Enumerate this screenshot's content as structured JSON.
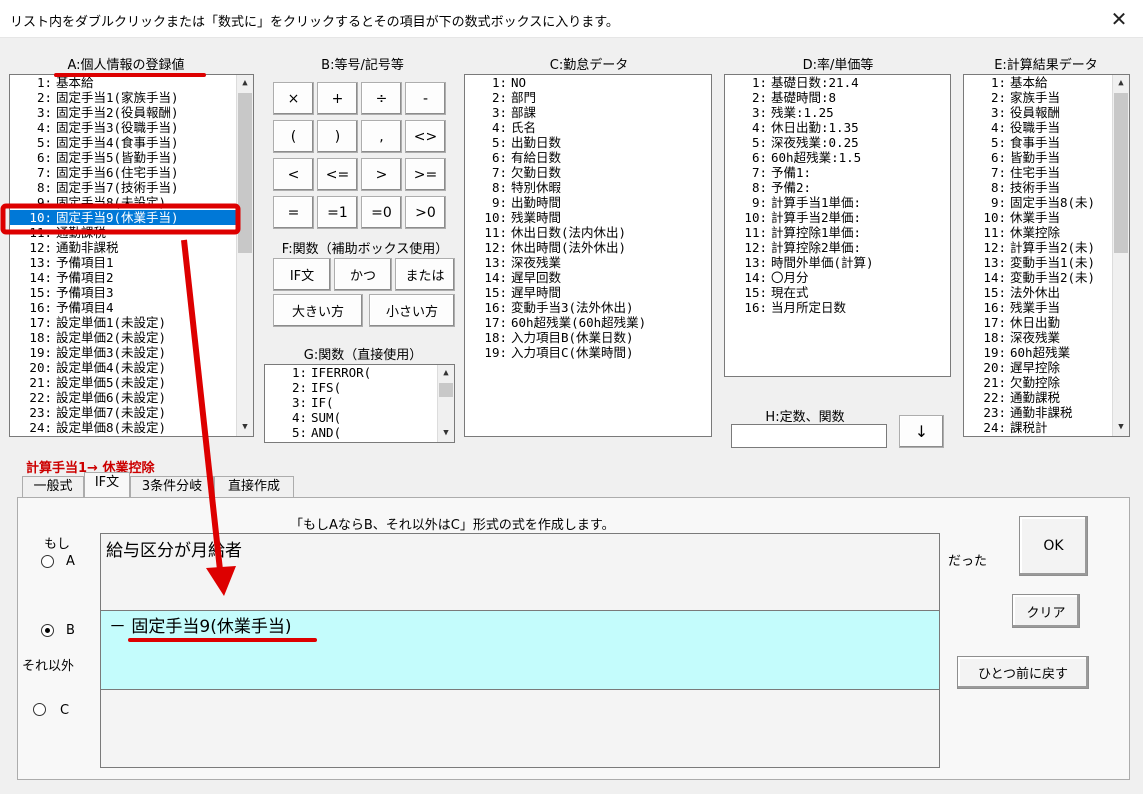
{
  "title": "リスト内をダブルクリックまたは「数式に」をクリックするとその項目が下の数式ボックスに入ります。",
  "close_glyph": "✕",
  "sections": {
    "a": "A:個人情報の登録値",
    "b": "B:等号/記号等",
    "c": "C:勤怠データ",
    "d": "D:率/単価等",
    "e": "E:計算結果データ",
    "f": "F:関数（補助ボックス使用）",
    "g": "G:関数（直接使用）",
    "h": "H:定数、関数"
  },
  "list_a": [
    {
      "n": "1:",
      "t": "基本給"
    },
    {
      "n": "2:",
      "t": "固定手当1(家族手当)"
    },
    {
      "n": "3:",
      "t": "固定手当2(役員報酬)"
    },
    {
      "n": "4:",
      "t": "固定手当3(役職手当)"
    },
    {
      "n": "5:",
      "t": "固定手当4(食事手当)"
    },
    {
      "n": "6:",
      "t": "固定手当5(皆勤手当)"
    },
    {
      "n": "7:",
      "t": "固定手当6(住宅手当)"
    },
    {
      "n": "8:",
      "t": "固定手当7(技術手当)"
    },
    {
      "n": "9:",
      "t": "固定手当8(未設定)"
    },
    {
      "n": "10:",
      "t": "固定手当9(休業手当)",
      "selected": true
    },
    {
      "n": "11:",
      "t": "通勤課税"
    },
    {
      "n": "12:",
      "t": "通勤非課税"
    },
    {
      "n": "13:",
      "t": "予備項目1"
    },
    {
      "n": "14:",
      "t": "予備項目2"
    },
    {
      "n": "15:",
      "t": "予備項目3"
    },
    {
      "n": "16:",
      "t": "予備項目4"
    },
    {
      "n": "17:",
      "t": "設定単価1(未設定)"
    },
    {
      "n": "18:",
      "t": "設定単価2(未設定)"
    },
    {
      "n": "19:",
      "t": "設定単価3(未設定)"
    },
    {
      "n": "20:",
      "t": "設定単価4(未設定)"
    },
    {
      "n": "21:",
      "t": "設定単価5(未設定)"
    },
    {
      "n": "22:",
      "t": "設定単価6(未設定)"
    },
    {
      "n": "23:",
      "t": "設定単価7(未設定)"
    },
    {
      "n": "24:",
      "t": "設定単価8(未設定)"
    }
  ],
  "symbols": [
    "×",
    "+",
    "÷",
    "-",
    "(",
    ")",
    ",",
    "<>",
    "<",
    "<=",
    ">",
    ">=",
    "=",
    "=1",
    "=0",
    ">0"
  ],
  "func_f": [
    "IF文",
    "かつ",
    "または",
    "大きい方",
    "小さい方"
  ],
  "list_g": [
    {
      "n": "1:",
      "t": "IFERROR("
    },
    {
      "n": "2:",
      "t": "IFS("
    },
    {
      "n": "3:",
      "t": "IF("
    },
    {
      "n": "4:",
      "t": "SUM("
    },
    {
      "n": "5:",
      "t": "AND("
    }
  ],
  "list_c": [
    {
      "n": "1:",
      "t": "NO"
    },
    {
      "n": "2:",
      "t": "部門"
    },
    {
      "n": "3:",
      "t": "部課"
    },
    {
      "n": "4:",
      "t": "氏名"
    },
    {
      "n": "5:",
      "t": "出勤日数"
    },
    {
      "n": "6:",
      "t": "有給日数"
    },
    {
      "n": "7:",
      "t": "欠勤日数"
    },
    {
      "n": "8:",
      "t": "特別休暇"
    },
    {
      "n": "9:",
      "t": "出勤時間"
    },
    {
      "n": "10:",
      "t": "残業時間"
    },
    {
      "n": "11:",
      "t": "休出日数(法内休出)"
    },
    {
      "n": "12:",
      "t": "休出時間(法外休出)"
    },
    {
      "n": "13:",
      "t": "深夜残業"
    },
    {
      "n": "14:",
      "t": "遅早回数"
    },
    {
      "n": "15:",
      "t": "遅早時間"
    },
    {
      "n": "16:",
      "t": "変動手当3(法外休出)"
    },
    {
      "n": "17:",
      "t": "60h超残業(60h超残業)"
    },
    {
      "n": "18:",
      "t": "入力項目B(休業日数)"
    },
    {
      "n": "19:",
      "t": "入力項目C(休業時間)"
    }
  ],
  "list_d": [
    {
      "n": "1:",
      "t": "基礎日数:21.4"
    },
    {
      "n": "2:",
      "t": "基礎時間:8"
    },
    {
      "n": "3:",
      "t": "残業:1.25"
    },
    {
      "n": "4:",
      "t": "休日出勤:1.35"
    },
    {
      "n": "5:",
      "t": "深夜残業:0.25"
    },
    {
      "n": "6:",
      "t": "60h超残業:1.5"
    },
    {
      "n": "7:",
      "t": "予備1:"
    },
    {
      "n": "8:",
      "t": "予備2:"
    },
    {
      "n": "9:",
      "t": "計算手当1単価:"
    },
    {
      "n": "10:",
      "t": "計算手当2単価:"
    },
    {
      "n": "11:",
      "t": "計算控除1単価:"
    },
    {
      "n": "12:",
      "t": "計算控除2単価:"
    },
    {
      "n": "13:",
      "t": "時間外単価(計算)"
    },
    {
      "n": "14:",
      "t": "〇月分"
    },
    {
      "n": "15:",
      "t": "現在式"
    },
    {
      "n": "16:",
      "t": "当月所定日数"
    }
  ],
  "list_e": [
    {
      "n": "1:",
      "t": "基本給"
    },
    {
      "n": "2:",
      "t": "家族手当"
    },
    {
      "n": "3:",
      "t": "役員報酬"
    },
    {
      "n": "4:",
      "t": "役職手当"
    },
    {
      "n": "5:",
      "t": "食事手当"
    },
    {
      "n": "6:",
      "t": "皆勤手当"
    },
    {
      "n": "7:",
      "t": "住宅手当"
    },
    {
      "n": "8:",
      "t": "技術手当"
    },
    {
      "n": "9:",
      "t": "固定手当8(未)"
    },
    {
      "n": "10:",
      "t": "休業手当"
    },
    {
      "n": "11:",
      "t": "休業控除"
    },
    {
      "n": "12:",
      "t": "計算手当2(未)"
    },
    {
      "n": "13:",
      "t": "変動手当1(未)"
    },
    {
      "n": "14:",
      "t": "変動手当2(未)"
    },
    {
      "n": "15:",
      "t": "法外休出"
    },
    {
      "n": "16:",
      "t": "残業手当"
    },
    {
      "n": "17:",
      "t": "休日出勤"
    },
    {
      "n": "18:",
      "t": "深夜残業"
    },
    {
      "n": "19:",
      "t": "60h超残業"
    },
    {
      "n": "20:",
      "t": "遅早控除"
    },
    {
      "n": "21:",
      "t": "欠勤控除"
    },
    {
      "n": "22:",
      "t": "通勤課税"
    },
    {
      "n": "23:",
      "t": "通勤非課税"
    },
    {
      "n": "24:",
      "t": "課税計"
    }
  ],
  "h_input": "",
  "h_button": "↓",
  "target_label": "計算手当1→ 休業控除",
  "tabs": [
    "一般式",
    "IF文",
    "3条件分岐",
    "直接作成"
  ],
  "active_tab": 1,
  "panel": {
    "instruction": "「もしAならB、それ以外はC」形式の式を作成します。",
    "if_label": "もし",
    "radio_a": "A",
    "radio_b": "B",
    "radio_c": "C",
    "else_label": "それ以外",
    "dattara": "だった",
    "box_a": "給与区分が月給者",
    "box_b": "－ 固定手当9(休業手当)",
    "box_c": "",
    "ok": "OK",
    "clear": "クリア",
    "undo": "ひとつ前に戻す"
  },
  "colors": {
    "selection": "#0078d7",
    "annotation_red": "#dd0000",
    "box_b_bg": "#c4fcfc"
  }
}
